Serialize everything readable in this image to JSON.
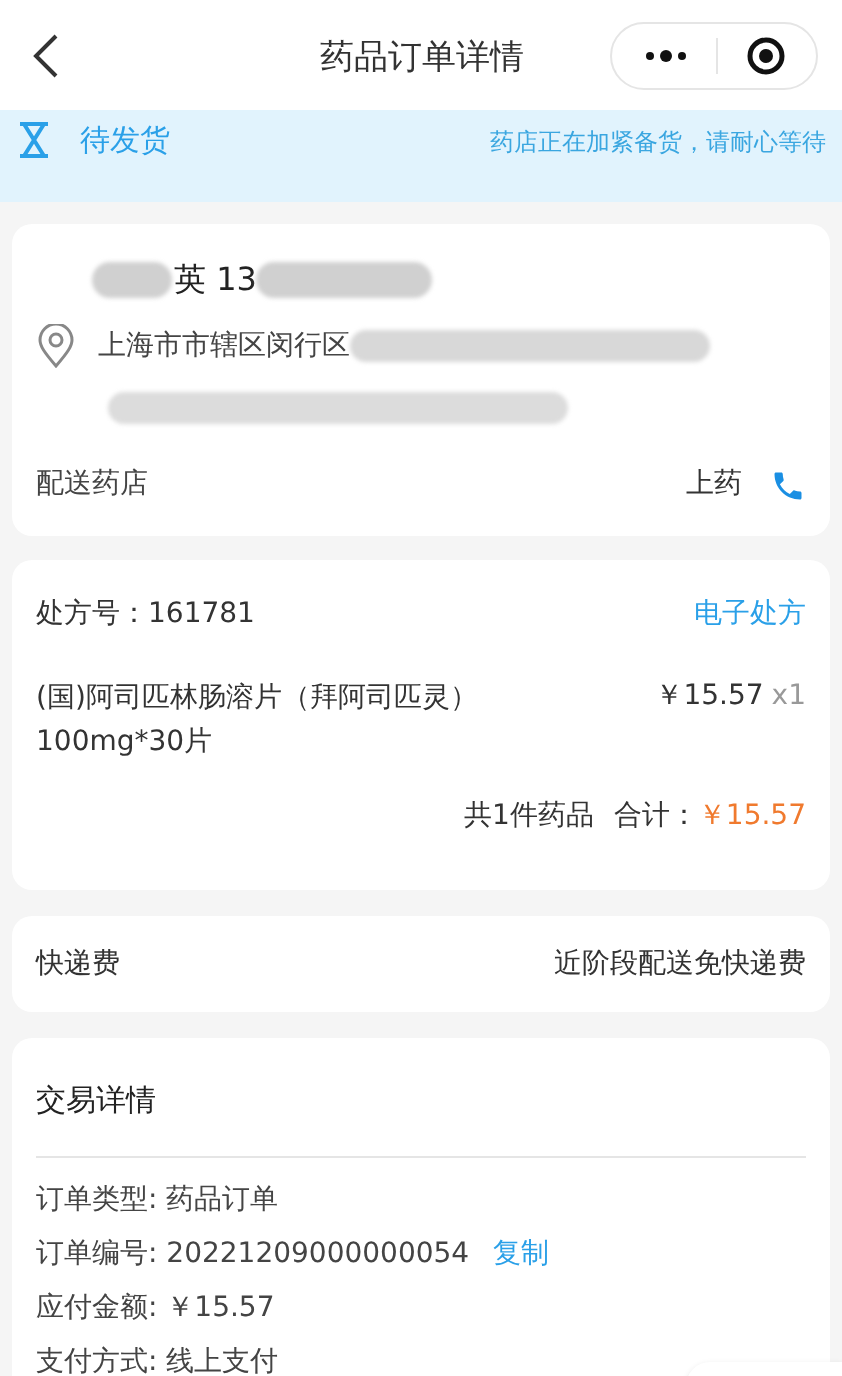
{
  "header": {
    "title": "药品订单详情"
  },
  "status_banner": {
    "status": "待发货",
    "message": "药店正在加紧备货，请耐心等待"
  },
  "address_card": {
    "name_visible": "英 13",
    "address_visible": "上海市市辖区闵行区",
    "pharmacy_label": "配送药店",
    "pharmacy_name": "上药"
  },
  "prescription_card": {
    "prescription_no": "处方号：161781",
    "e_prescription_link": "电子处方",
    "items": [
      {
        "name": "(国)阿司匹林肠溶片（拜阿司匹灵）100mg*30片",
        "price": "￥15.57",
        "quantity": "x1"
      }
    ],
    "summary_count": "共1件药品",
    "summary_total_label": "合计：",
    "summary_total": "￥15.57"
  },
  "shipping": {
    "label": "快递费",
    "value": "近阶段配送免快递费"
  },
  "transaction": {
    "title": "交易详情",
    "rows": [
      {
        "label": "订单类型: ",
        "value": "药品订单"
      },
      {
        "label": "订单编号: ",
        "value": "20221209000000054",
        "action": "复制"
      },
      {
        "label": "应付金额: ",
        "value": "￥15.57"
      },
      {
        "label": "支付方式: ",
        "value": "线上支付"
      }
    ]
  }
}
